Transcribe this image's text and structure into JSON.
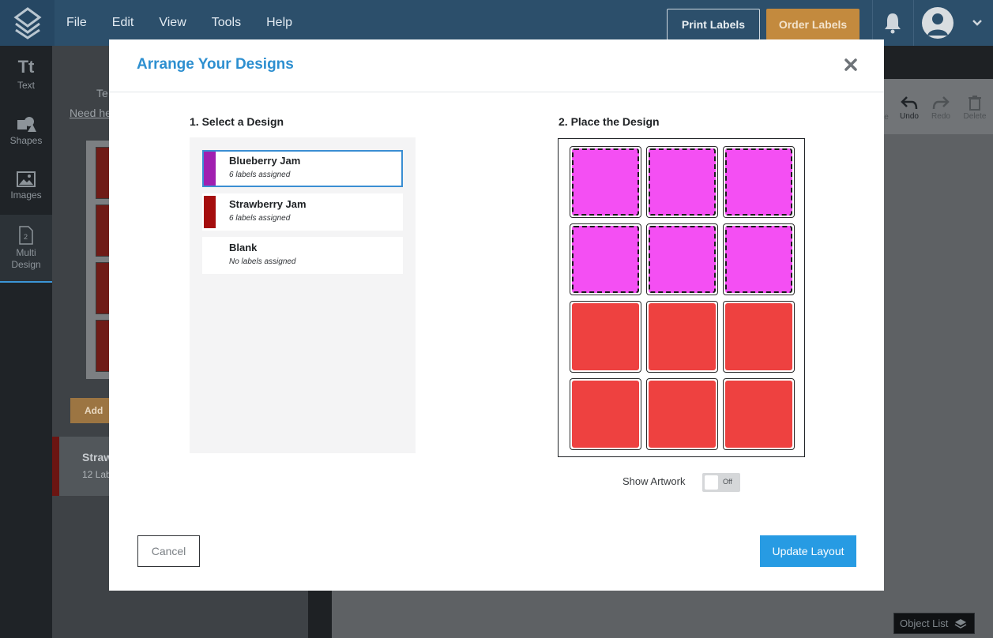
{
  "menu": {
    "items": [
      "File",
      "Edit",
      "View",
      "Tools",
      "Help"
    ]
  },
  "header": {
    "print_label": "Print Labels",
    "order_label": "Order Labels"
  },
  "rail": {
    "items": [
      {
        "label": "Text",
        "icon": "text-icon"
      },
      {
        "label": "Shapes",
        "icon": "shapes-icon"
      },
      {
        "label": "Images",
        "icon": "images-icon"
      },
      {
        "label": "Multi Design",
        "icon": "multi-design-icon"
      }
    ]
  },
  "panel": {
    "title": "Te",
    "help": "Need he",
    "add_button": "Add",
    "card_title": "Straw",
    "card_sub": "12 Lab"
  },
  "toolbar": {
    "items": [
      "e",
      "Undo",
      "Redo",
      "Delete"
    ]
  },
  "object_list": "Object List",
  "modal": {
    "title": "Arrange Your Designs",
    "step1": "1. Select a Design",
    "step2": "2. Place the Design",
    "designs": [
      {
        "name": "Blueberry Jam",
        "sub": "6 labels assigned",
        "color": "#a01fb0",
        "selected": true
      },
      {
        "name": "Strawberry Jam",
        "sub": "6 labels assigned",
        "color": "#a50d0d",
        "selected": false
      },
      {
        "name": "Blank",
        "sub": "No labels assigned",
        "color": "",
        "selected": false
      }
    ],
    "sheet": {
      "rows": 4,
      "cols": 3,
      "cells": [
        "blueberry",
        "blueberry",
        "blueberry",
        "blueberry",
        "blueberry",
        "blueberry",
        "strawberry",
        "strawberry",
        "strawberry",
        "strawberry",
        "strawberry",
        "strawberry"
      ],
      "colors": {
        "blueberry": "#f44ff3",
        "strawberry": "#ee4140"
      }
    },
    "show_artwork_label": "Show Artwork",
    "toggle_state": "Off",
    "cancel": "Cancel",
    "update": "Update Layout"
  }
}
